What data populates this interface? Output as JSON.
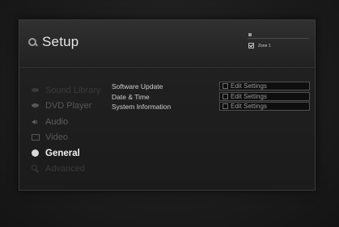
{
  "header": {
    "title": "Setup",
    "zone_label": "Zone 1"
  },
  "sidebar": {
    "items": [
      {
        "label": "Sound Library",
        "icon": "music-icon",
        "state": "faint"
      },
      {
        "label": "DVD Player",
        "icon": "dvd-icon",
        "state": "dim"
      },
      {
        "label": "Audio",
        "icon": "speaker-icon",
        "state": "dim"
      },
      {
        "label": "Video",
        "icon": "monitor-icon",
        "state": "dim"
      },
      {
        "label": "General",
        "icon": "ball-icon",
        "state": "active"
      },
      {
        "label": "Advanced",
        "icon": "magnifier-icon",
        "state": "dim"
      }
    ]
  },
  "settings": {
    "rows": [
      {
        "label": "Software Update",
        "button": "Edit Settings"
      },
      {
        "label": "Date & Time",
        "button": "Edit Settings"
      },
      {
        "label": "System Information",
        "button": "Edit Settings"
      }
    ]
  }
}
